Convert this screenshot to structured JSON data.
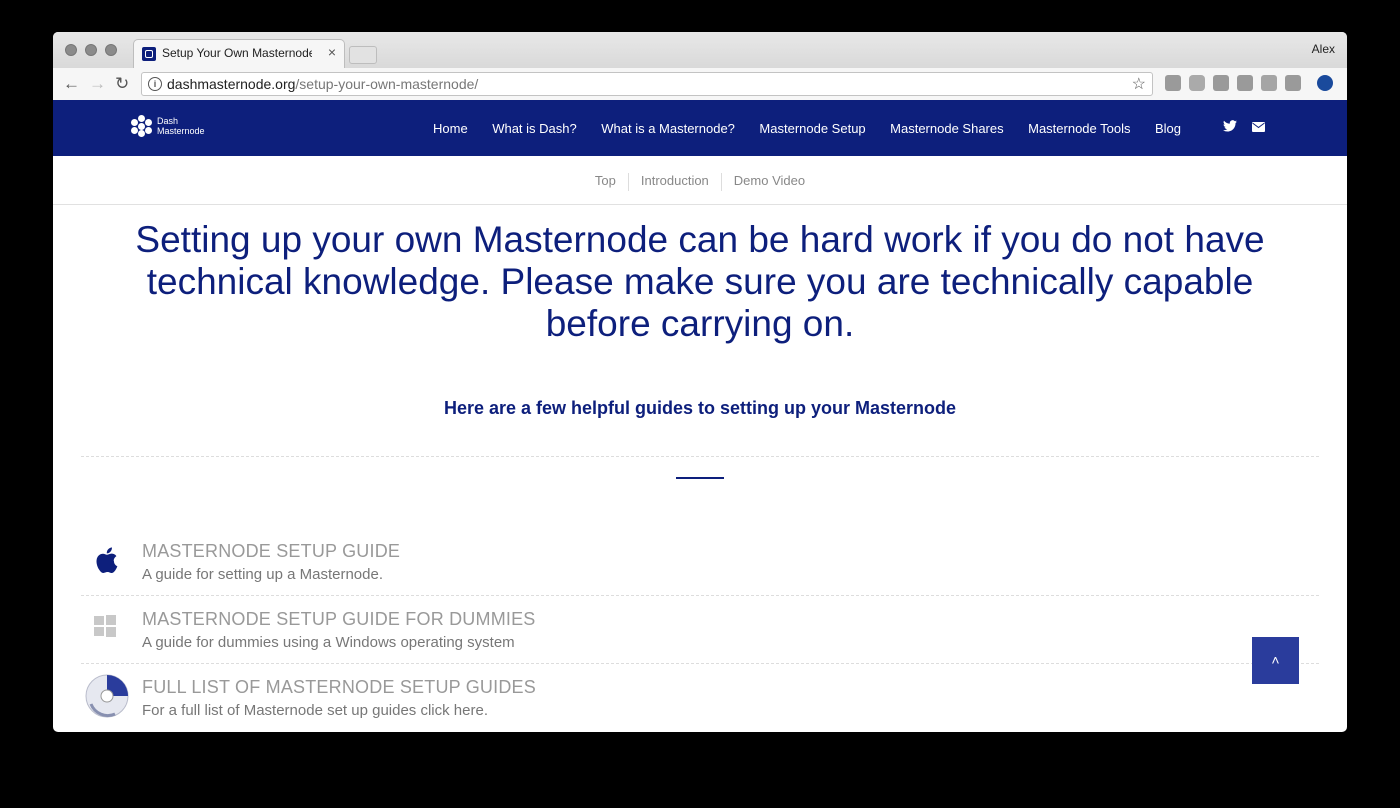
{
  "browser": {
    "tab_title": "Setup Your Own Masternode",
    "tab_close": "×",
    "profile_name": "Alex",
    "url_domain": "dashmasternode.org",
    "url_path": "/setup-your-own-masternode/",
    "back_icon": "←",
    "forward_icon": "→",
    "reload_icon": "↻",
    "star_icon": "☆"
  },
  "site": {
    "logo_line1": "Dash",
    "logo_line2": "Masternode",
    "nav": [
      "Home",
      "What is Dash?",
      "What is a Masternode?",
      "Masternode Setup",
      "Masternode Shares",
      "Masternode Tools",
      "Blog"
    ],
    "twitter_icon": "🐦",
    "mail_icon": "✉"
  },
  "subnav": {
    "items": [
      "Top",
      "Introduction",
      "Demo Video"
    ]
  },
  "main": {
    "headline": "Setting up your own Masternode can be hard work if you do not have technical knowledge. Please make sure you are technically capable before carrying on.",
    "subheadline": "Here are a few helpful guides to setting up your Masternode",
    "guides": [
      {
        "title": "MASTERNODE SETUP GUIDE",
        "desc": "A guide for setting up a Masternode.",
        "icon": "apple-icon"
      },
      {
        "title": "MASTERNODE SETUP GUIDE FOR DUMMIES",
        "desc": "A guide for dummies using a Windows operating system",
        "icon": "windows-icon"
      },
      {
        "title": "FULL LIST OF MASTERNODE SETUP GUIDES",
        "desc": "For a full list of Masternode set up guides click here.",
        "icon": "ubuntu-disc-icon"
      }
    ],
    "to_top": "˄"
  },
  "colors": {
    "brand": "#0d1f7c",
    "muted_text": "#999999"
  }
}
